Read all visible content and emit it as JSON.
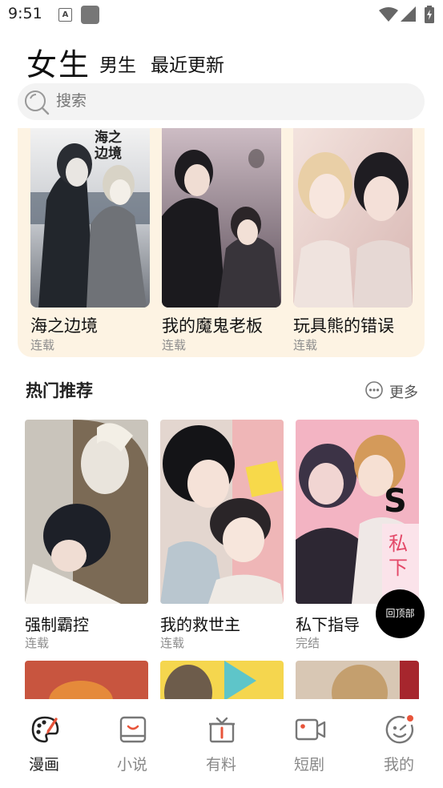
{
  "status_bar": {
    "time": "9:51",
    "notif_icon_letter": "A"
  },
  "tabs": {
    "main": "女生",
    "tab2": "男生",
    "tab3": "最近更新"
  },
  "search": {
    "placeholder": "搜索"
  },
  "featured": [
    {
      "title": "海之边境",
      "status": "连载",
      "cover_text": "海之\n边境"
    },
    {
      "title": "我的魔鬼老板",
      "status": "连载"
    },
    {
      "title": "玩具熊的错误",
      "status": "连载"
    }
  ],
  "hot": {
    "title": "热门推荐",
    "more_label": "更多",
    "items": [
      {
        "title": "强制霸控",
        "status": "连载"
      },
      {
        "title": "我的救世主",
        "status": "连载"
      },
      {
        "title": "私下指导",
        "status": "完结",
        "cover_text": "私下"
      }
    ]
  },
  "back_to_top": "回顶部",
  "bottom_nav": [
    {
      "label": "漫画",
      "icon": "palette-icon",
      "active": true
    },
    {
      "label": "小说",
      "icon": "book-icon",
      "active": false
    },
    {
      "label": "有料",
      "icon": "gift-icon",
      "active": false
    },
    {
      "label": "短剧",
      "icon": "video-icon",
      "active": false
    },
    {
      "label": "我的",
      "icon": "face-icon",
      "active": false
    }
  ],
  "colors": {
    "featured_bg": "#fdf3e3",
    "search_bg": "#f3f3f3",
    "badge_red": "#e8543a"
  }
}
